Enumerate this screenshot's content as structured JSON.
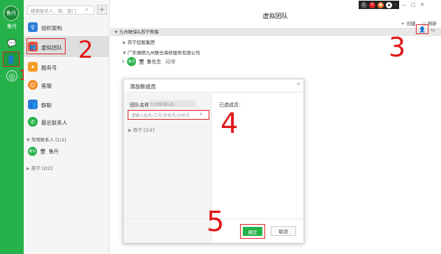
{
  "rail": {
    "avatar_text": "鲁丹",
    "user_name": "鲁丹"
  },
  "search": {
    "placeholder": "搜索联系人、群、部门"
  },
  "list": {
    "items": [
      {
        "label": "组织架构"
      },
      {
        "label": "虚拟团队"
      },
      {
        "label": "服务号"
      },
      {
        "label": "客服"
      },
      {
        "label": "群聊"
      },
      {
        "label": "最近联系人"
      }
    ],
    "common_contacts": "常用联系人 [1/1]",
    "contact_name": "鲁丹",
    "suning": "苏宁 [2/2]"
  },
  "main": {
    "title": "虚拟团队",
    "create": "创建",
    "refresh": "刷新",
    "tree": [
      "九州联保&苏宁帮客",
      "苏宁控股集团",
      "广东顺德九州联合保修服务有限公司"
    ],
    "member": {
      "avatar": "鲁丹",
      "name": "鲁先生",
      "role": "经理"
    }
  },
  "dialog": {
    "title": "添加新成员",
    "team_label": "团队名称",
    "team_value": "九州联保&苏...",
    "input_placeholder": "请输入姓名/工号/手机号/分机号",
    "sub_tree": "苏宁 [2/2]",
    "selected_label": "已选成员：",
    "ok": "确定",
    "cancel": "取消"
  },
  "annotations": [
    "1",
    "2",
    "3",
    "4",
    "5"
  ],
  "colors": {
    "green": "#26b24a",
    "annotation_red": "#e02020"
  }
}
